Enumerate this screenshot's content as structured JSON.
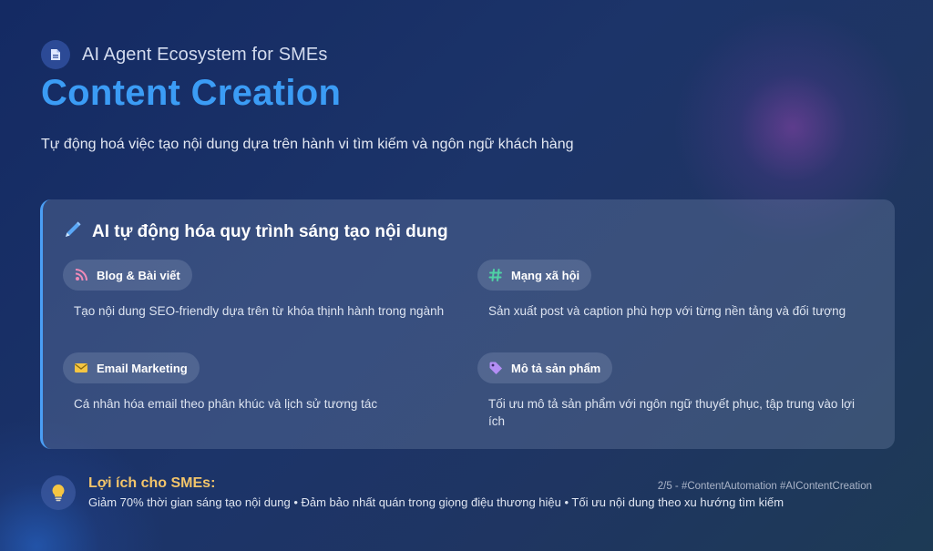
{
  "header": {
    "eyebrow": "AI Agent Ecosystem for SMEs",
    "title": "Content Creation",
    "subtitle": "Tự động hoá việc tạo nội dung dựa trên hành vi tìm kiếm và ngôn ngữ khách hàng"
  },
  "card": {
    "title": "AI tự động hóa quy trình sáng tạo nội dung",
    "features": [
      {
        "label": "Blog & Bài viết",
        "icon": "blog-icon",
        "desc": "Tạo nội dung SEO-friendly dựa trên từ khóa thịnh hành trong ngành"
      },
      {
        "label": "Mạng xã hội",
        "icon": "hashtag-icon",
        "desc": "Sản xuất post và caption phù hợp với từng nền tảng và đối tượng"
      },
      {
        "label": "Email Marketing",
        "icon": "envelope-icon",
        "desc": "Cá nhân hóa email theo phân khúc và lịch sử tương tác"
      },
      {
        "label": "Mô tả sản phẩm",
        "icon": "tag-icon",
        "desc": "Tối ưu mô tả sản phẩm với ngôn ngữ thuyết phục, tập trung vào lợi ích"
      }
    ]
  },
  "footer": {
    "title": "Lợi ích cho SMEs:",
    "text": "Giảm 70% thời gian sáng tạo nội dung • Đảm bảo nhất quán trong giọng điệu thương hiệu • Tối ưu nội dung theo xu hướng tìm kiếm",
    "meta": "2/5 - #ContentAutomation #AIContentCreation"
  },
  "colors": {
    "title": "#3b9cf5",
    "accent_border": "#4a9ef5",
    "benefit_title": "#f3c56a",
    "blog_icon": "#f08ab8",
    "hashtag_icon": "#4fd1a5",
    "envelope_icon": "#f5c542",
    "tag_icon": "#b48ef5"
  }
}
